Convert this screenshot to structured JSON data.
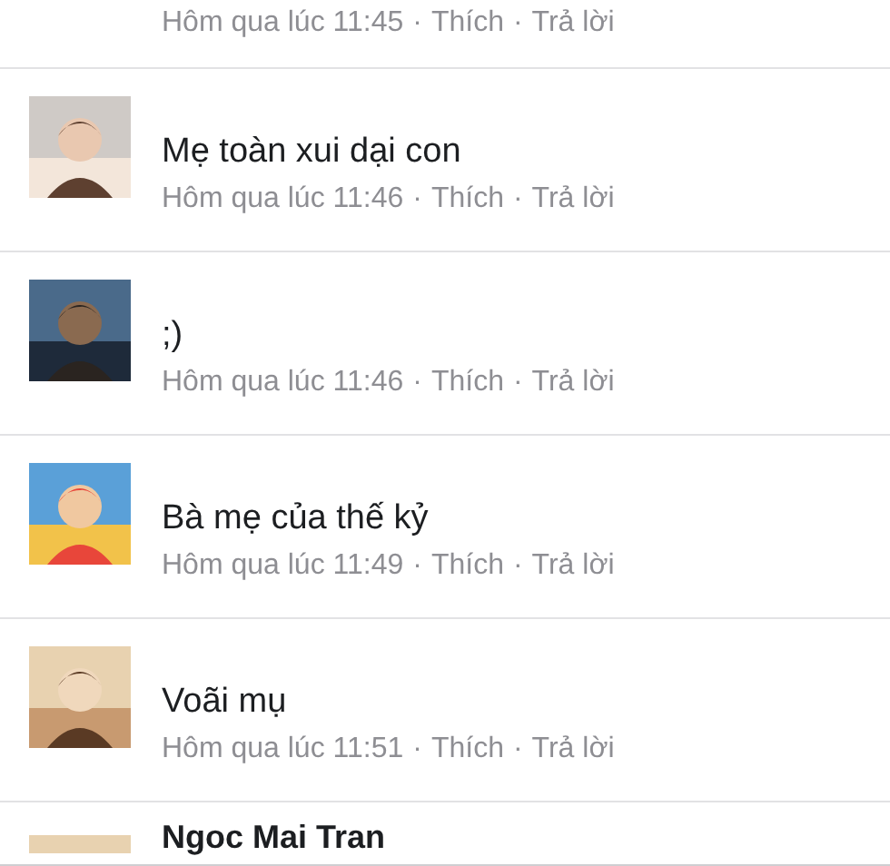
{
  "separator": "·",
  "comments": [
    {
      "kind": "meta",
      "time": "Hôm qua lúc 11:45",
      "like": "Thích",
      "reply": "Trả lời"
    },
    {
      "kind": "comment",
      "text": "Mẹ toàn xui dại con",
      "time": "Hôm qua lúc 11:46",
      "like": "Thích",
      "reply": "Trả lời"
    },
    {
      "kind": "comment",
      "text": ";)",
      "time": "Hôm qua lúc 11:46",
      "like": "Thích",
      "reply": "Trả lời"
    },
    {
      "kind": "comment",
      "text": "Bà mẹ của thế kỷ",
      "time": "Hôm qua lúc 11:49",
      "like": "Thích",
      "reply": "Trả lời"
    },
    {
      "kind": "comment",
      "text": "Voãi mụ",
      "time": "Hôm qua lúc 11:51",
      "like": "Thích",
      "reply": "Trả lời"
    }
  ],
  "next": {
    "name": "Ngoc Mai Tran"
  }
}
